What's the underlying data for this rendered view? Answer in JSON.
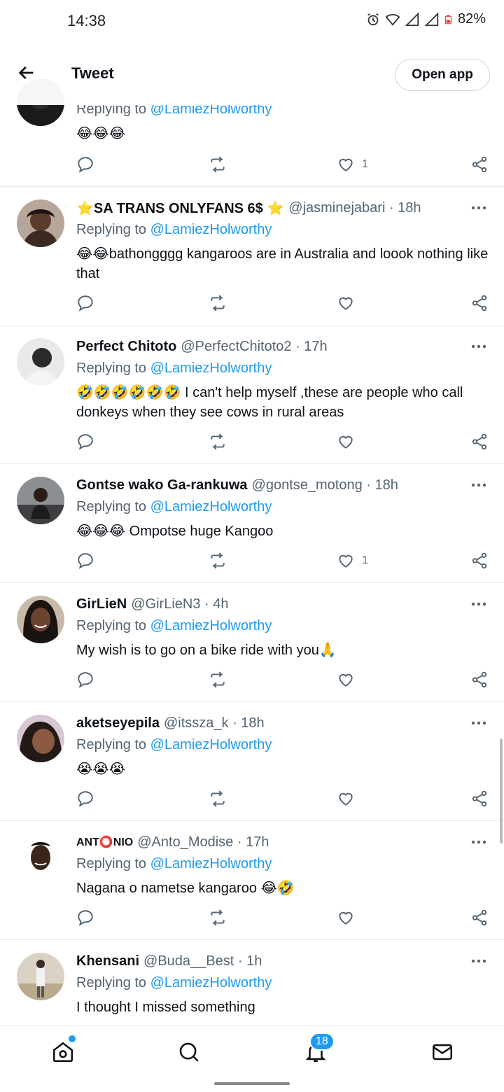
{
  "status_bar": {
    "time": "14:38",
    "battery": "82%"
  },
  "header": {
    "title": "Tweet",
    "open_app": "Open app"
  },
  "replying_prefix": "Replying to",
  "replies": [
    {
      "name": "",
      "handle": "",
      "time": "",
      "replying_to": "@LamiezHolworthy",
      "text": "😂😂😂",
      "likes": "1"
    },
    {
      "name": "⭐SA TRANS ONLYFANS 6$ ⭐",
      "handle": "@jasminejabari · 18h",
      "replying_to": "@LamiezHolworthy",
      "text": "😂😂bathongggg kangaroos are in Australia and loook nothing like that",
      "likes": ""
    },
    {
      "name": "Perfect Chitoto",
      "handle": "@PerfectChitoto2 · 17h",
      "replying_to": "@LamiezHolworthy",
      "text": "🤣🤣🤣🤣🤣🤣 I can't help myself ,these are people who call donkeys when they see cows in rural areas",
      "likes": ""
    },
    {
      "name": "Gontse wako Ga-rankuwa",
      "handle": "@gontse_motong · 18h",
      "replying_to": "@LamiezHolworthy",
      "text": "😂😂😂 Ompotse huge Kangoo",
      "likes": "1"
    },
    {
      "name": "GirLieN",
      "handle": "@GirLieN3 · 4h",
      "replying_to": "@LamiezHolworthy",
      "text": "My wish is to go on a bike ride with you🙏",
      "likes": ""
    },
    {
      "name": "aketseyepila",
      "handle": "@itssza_k · 18h",
      "replying_to": "@LamiezHolworthy",
      "text": "😭😭😭",
      "likes": ""
    },
    {
      "name": "ANT⭕NIO",
      "handle": "@Anto_Modise · 17h",
      "replying_to": "@LamiezHolworthy",
      "text": "Nagana o nametse kangaroo 😂🤣",
      "likes": ""
    },
    {
      "name": "Khensani",
      "handle": "@Buda__Best · 1h",
      "replying_to": "@LamiezHolworthy",
      "text": "I thought I missed something",
      "likes": ""
    }
  ],
  "nav": {
    "notifications_badge": "18"
  },
  "colors": {
    "accent": "#1d9bf0",
    "text": "#0f1419",
    "secondary": "#536471",
    "divider": "#e6ecf0"
  }
}
